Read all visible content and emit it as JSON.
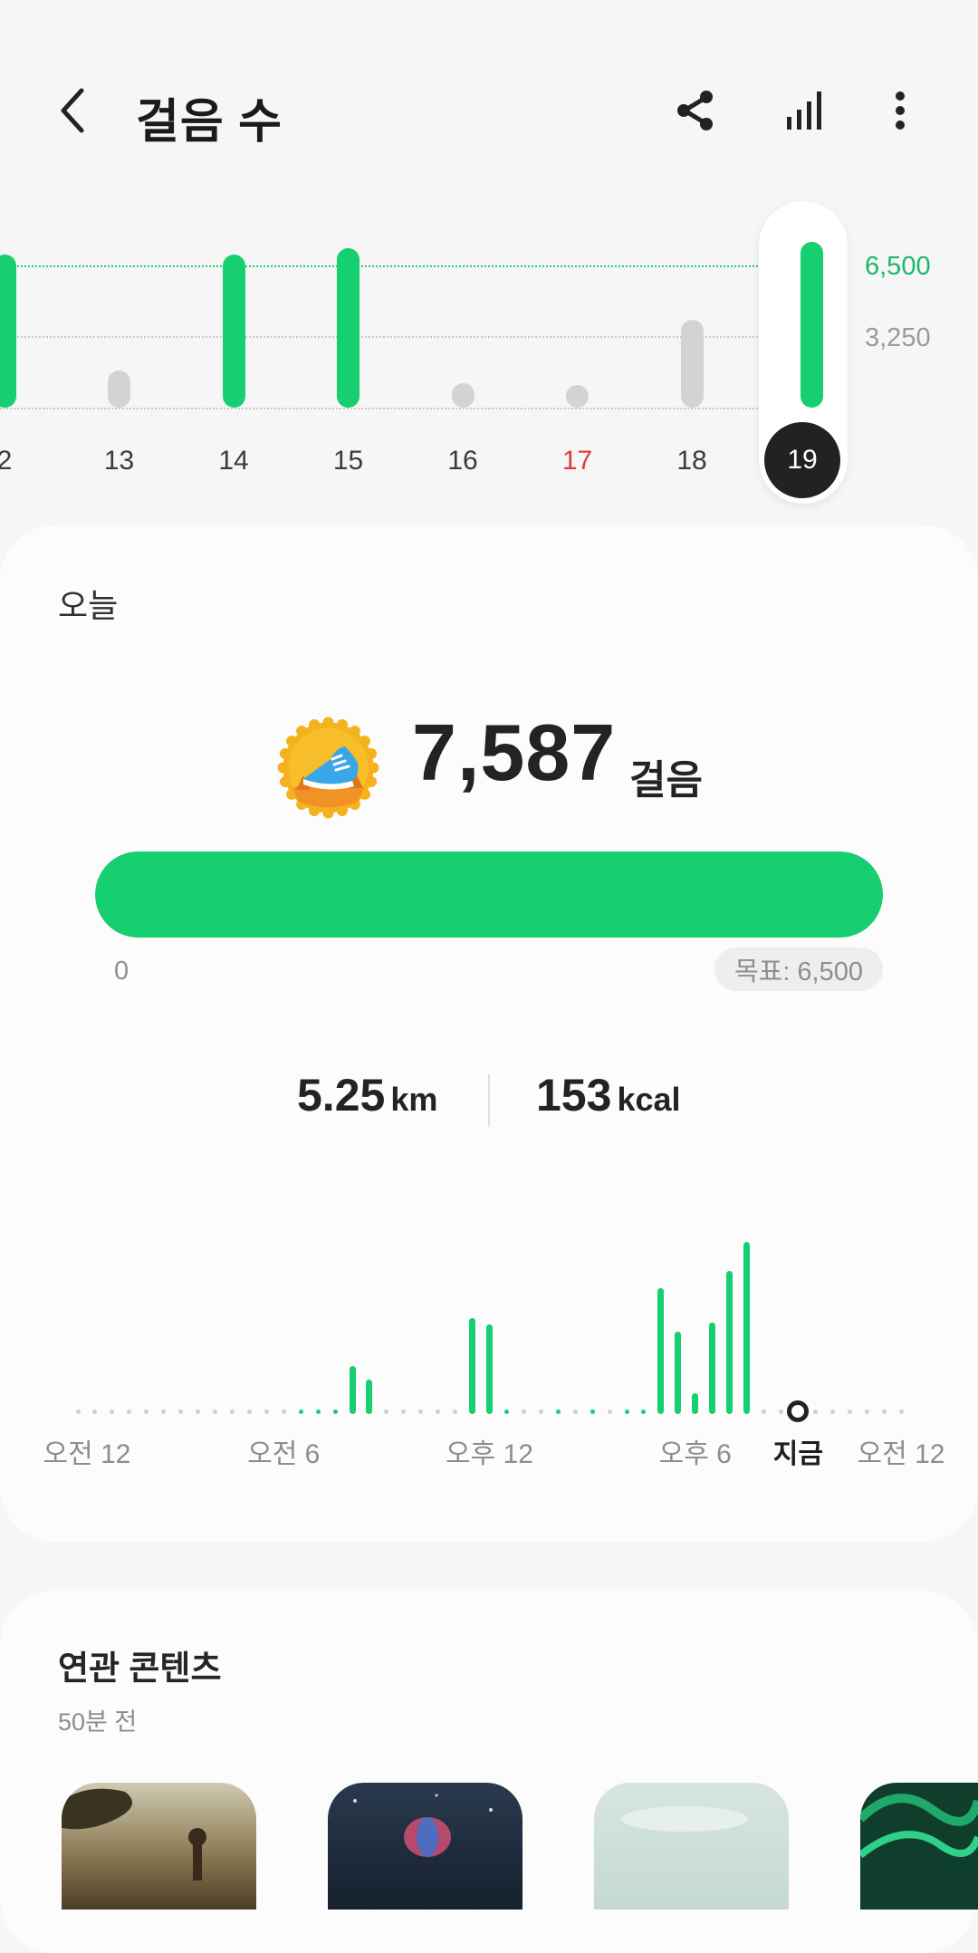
{
  "header": {
    "title": "걸음 수",
    "back_icon": "chevron-left-icon",
    "share_icon": "share-icon",
    "stats_icon": "bar-chart-icon",
    "more_icon": "more-vertical-icon"
  },
  "colors": {
    "accent_green": "#15cf70",
    "inactive_bar": "#d3d3d3",
    "sunday_red": "#e23a3a",
    "selected_day_bg": "#222222"
  },
  "daily_chart": {
    "y_labels": {
      "goal": "6,500",
      "half": "3,250"
    },
    "goal": 6500,
    "days": [
      {
        "label": "2",
        "steps": 7000,
        "met_goal": true
      },
      {
        "label": "13",
        "steps": 1700,
        "met_goal": false
      },
      {
        "label": "14",
        "steps": 7000,
        "met_goal": true
      },
      {
        "label": "15",
        "steps": 7300,
        "met_goal": true
      },
      {
        "label": "16",
        "steps": 1100,
        "met_goal": false
      },
      {
        "label": "17",
        "steps": 0,
        "met_goal": false,
        "sunday": true
      },
      {
        "label": "18",
        "steps": 4000,
        "met_goal": false
      },
      {
        "label": "19",
        "steps": 7587,
        "met_goal": true,
        "selected": true
      }
    ]
  },
  "today": {
    "label": "오늘",
    "steps": "7,587",
    "steps_unit": "걸음",
    "badge_icon": "sneaker-badge-icon",
    "progress_fraction": 1.0,
    "progress_min": "0",
    "goal_text": "목표: 6,500",
    "distance": "5.25",
    "distance_unit": "km",
    "calories": "153",
    "calories_unit": "kcal"
  },
  "hourly_chart": {
    "x_labels": [
      "오전 12",
      "오전 6",
      "오후 12",
      "오후 6",
      "지금",
      "오전 12"
    ],
    "current_label": "지금",
    "slots_per_hour": 2,
    "now_slot": 42,
    "activity": [
      {
        "slot": 13,
        "level": 0.02
      },
      {
        "slot": 14,
        "level": 0.01
      },
      {
        "slot": 15,
        "level": 0.02
      },
      {
        "slot": 16,
        "level": 0.28
      },
      {
        "slot": 17,
        "level": 0.2
      },
      {
        "slot": 23,
        "level": 0.56
      },
      {
        "slot": 24,
        "level": 0.52
      },
      {
        "slot": 25,
        "level": 0.03
      },
      {
        "slot": 28,
        "level": 0.02
      },
      {
        "slot": 30,
        "level": 0.02
      },
      {
        "slot": 32,
        "level": 0.02
      },
      {
        "slot": 33,
        "level": 0.02
      },
      {
        "slot": 34,
        "level": 0.73
      },
      {
        "slot": 35,
        "level": 0.48
      },
      {
        "slot": 36,
        "level": 0.12
      },
      {
        "slot": 37,
        "level": 0.53
      },
      {
        "slot": 38,
        "level": 0.83
      },
      {
        "slot": 39,
        "level": 1.0
      }
    ]
  },
  "related": {
    "title": "연관 콘텐츠",
    "subtitle": "50분 전",
    "thumbnails": [
      "sunset-tree-photo",
      "night-sky-balloon-photo",
      "pale-sky-photo",
      "green-swirl-photo"
    ]
  }
}
